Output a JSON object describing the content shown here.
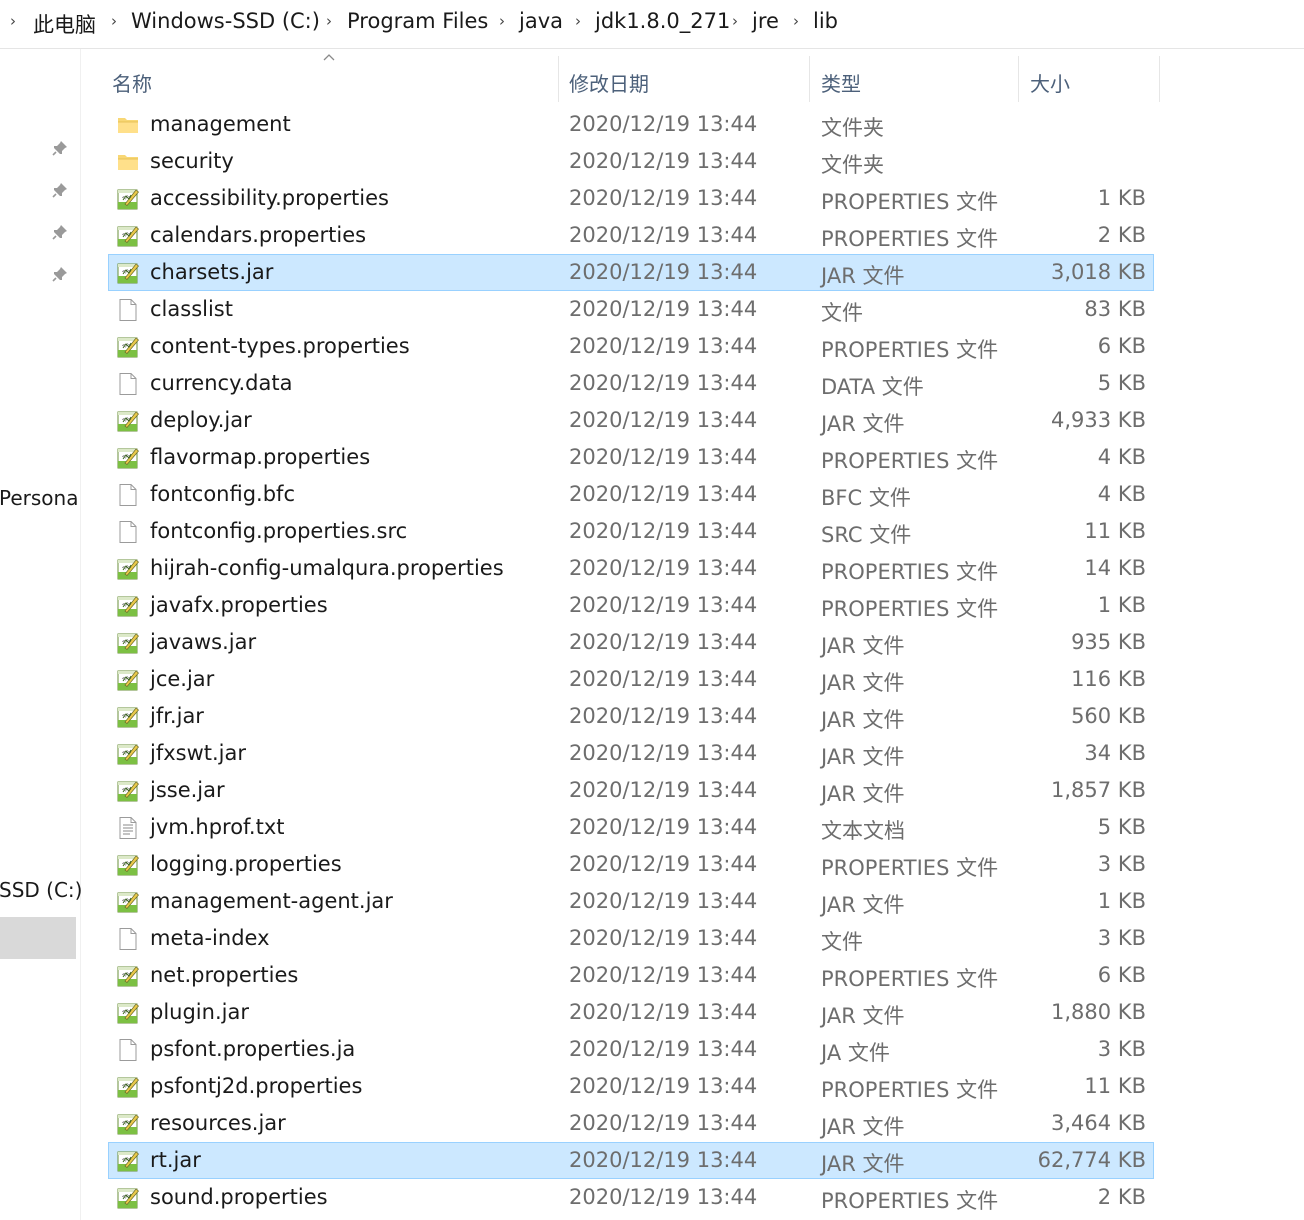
{
  "breadcrumb": [
    "此电脑",
    "Windows-SSD (C:)",
    "Program Files",
    "java",
    "jdk1.8.0_271",
    "jre",
    "lib"
  ],
  "nav": {
    "pinned_count": 4,
    "label_personal": "Persona",
    "label_drive": "SSD (C:)"
  },
  "columns": {
    "name": "名称",
    "date": "修改日期",
    "type": "类型",
    "size": "大小"
  },
  "files": [
    {
      "name": "management",
      "date": "2020/12/19 13:44",
      "type": "文件夹",
      "size": "",
      "icon": "folder-icon"
    },
    {
      "name": "security",
      "date": "2020/12/19 13:44",
      "type": "文件夹",
      "size": "",
      "icon": "folder-icon"
    },
    {
      "name": "accessibility.properties",
      "date": "2020/12/19 13:44",
      "type": "PROPERTIES 文件",
      "size": "1 KB",
      "icon": "notepadpp-file-icon"
    },
    {
      "name": "calendars.properties",
      "date": "2020/12/19 13:44",
      "type": "PROPERTIES 文件",
      "size": "2 KB",
      "icon": "notepadpp-file-icon"
    },
    {
      "name": "charsets.jar",
      "date": "2020/12/19 13:44",
      "type": "JAR 文件",
      "size": "3,018 KB",
      "icon": "notepadpp-file-icon",
      "selected": true
    },
    {
      "name": "classlist",
      "date": "2020/12/19 13:44",
      "type": "文件",
      "size": "83 KB",
      "icon": "blank-file-icon"
    },
    {
      "name": "content-types.properties",
      "date": "2020/12/19 13:44",
      "type": "PROPERTIES 文件",
      "size": "6 KB",
      "icon": "notepadpp-file-icon"
    },
    {
      "name": "currency.data",
      "date": "2020/12/19 13:44",
      "type": "DATA 文件",
      "size": "5 KB",
      "icon": "blank-file-icon"
    },
    {
      "name": "deploy.jar",
      "date": "2020/12/19 13:44",
      "type": "JAR 文件",
      "size": "4,933 KB",
      "icon": "notepadpp-file-icon"
    },
    {
      "name": "flavormap.properties",
      "date": "2020/12/19 13:44",
      "type": "PROPERTIES 文件",
      "size": "4 KB",
      "icon": "notepadpp-file-icon"
    },
    {
      "name": "fontconfig.bfc",
      "date": "2020/12/19 13:44",
      "type": "BFC 文件",
      "size": "4 KB",
      "icon": "blank-file-icon"
    },
    {
      "name": "fontconfig.properties.src",
      "date": "2020/12/19 13:44",
      "type": "SRC 文件",
      "size": "11 KB",
      "icon": "blank-file-icon"
    },
    {
      "name": "hijrah-config-umalqura.properties",
      "date": "2020/12/19 13:44",
      "type": "PROPERTIES 文件",
      "size": "14 KB",
      "icon": "notepadpp-file-icon"
    },
    {
      "name": "javafx.properties",
      "date": "2020/12/19 13:44",
      "type": "PROPERTIES 文件",
      "size": "1 KB",
      "icon": "notepadpp-file-icon"
    },
    {
      "name": "javaws.jar",
      "date": "2020/12/19 13:44",
      "type": "JAR 文件",
      "size": "935 KB",
      "icon": "notepadpp-file-icon"
    },
    {
      "name": "jce.jar",
      "date": "2020/12/19 13:44",
      "type": "JAR 文件",
      "size": "116 KB",
      "icon": "notepadpp-file-icon"
    },
    {
      "name": "jfr.jar",
      "date": "2020/12/19 13:44",
      "type": "JAR 文件",
      "size": "560 KB",
      "icon": "notepadpp-file-icon"
    },
    {
      "name": "jfxswt.jar",
      "date": "2020/12/19 13:44",
      "type": "JAR 文件",
      "size": "34 KB",
      "icon": "notepadpp-file-icon"
    },
    {
      "name": "jsse.jar",
      "date": "2020/12/19 13:44",
      "type": "JAR 文件",
      "size": "1,857 KB",
      "icon": "notepadpp-file-icon"
    },
    {
      "name": "jvm.hprof.txt",
      "date": "2020/12/19 13:44",
      "type": "文本文档",
      "size": "5 KB",
      "icon": "text-file-icon"
    },
    {
      "name": "logging.properties",
      "date": "2020/12/19 13:44",
      "type": "PROPERTIES 文件",
      "size": "3 KB",
      "icon": "notepadpp-file-icon"
    },
    {
      "name": "management-agent.jar",
      "date": "2020/12/19 13:44",
      "type": "JAR 文件",
      "size": "1 KB",
      "icon": "notepadpp-file-icon"
    },
    {
      "name": "meta-index",
      "date": "2020/12/19 13:44",
      "type": "文件",
      "size": "3 KB",
      "icon": "blank-file-icon"
    },
    {
      "name": "net.properties",
      "date": "2020/12/19 13:44",
      "type": "PROPERTIES 文件",
      "size": "6 KB",
      "icon": "notepadpp-file-icon"
    },
    {
      "name": "plugin.jar",
      "date": "2020/12/19 13:44",
      "type": "JAR 文件",
      "size": "1,880 KB",
      "icon": "notepadpp-file-icon"
    },
    {
      "name": "psfont.properties.ja",
      "date": "2020/12/19 13:44",
      "type": "JA 文件",
      "size": "3 KB",
      "icon": "blank-file-icon"
    },
    {
      "name": "psfontj2d.properties",
      "date": "2020/12/19 13:44",
      "type": "PROPERTIES 文件",
      "size": "11 KB",
      "icon": "notepadpp-file-icon"
    },
    {
      "name": "resources.jar",
      "date": "2020/12/19 13:44",
      "type": "JAR 文件",
      "size": "3,464 KB",
      "icon": "notepadpp-file-icon"
    },
    {
      "name": "rt.jar",
      "date": "2020/12/19 13:44",
      "type": "JAR 文件",
      "size": "62,774 KB",
      "icon": "notepadpp-file-icon",
      "selected": true
    },
    {
      "name": "sound.properties",
      "date": "2020/12/19 13:44",
      "type": "PROPERTIES 文件",
      "size": "2 KB",
      "icon": "notepadpp-file-icon"
    }
  ],
  "colors": {
    "selection_bg": "#cce8ff",
    "selection_border": "#99d1ff",
    "header_text": "#4c607a",
    "folder": "#f8d775",
    "nav_selected": "#d9d9d9"
  }
}
